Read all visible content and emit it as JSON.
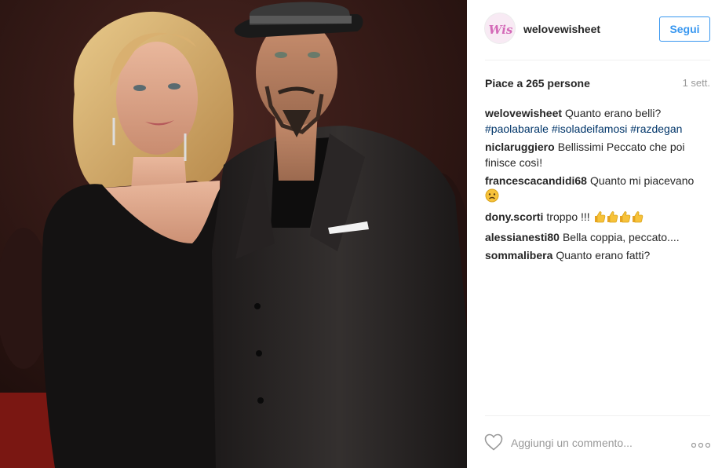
{
  "post": {
    "username": "welovewisheet",
    "avatar_text": "Wis",
    "follow_label": "Segui",
    "likes_text": "Piace a 265 persone",
    "time_text": "1 sett.",
    "comment_placeholder": "Aggiungi un commento...",
    "caption": {
      "user": "welovewisheet",
      "text": "Quanto erano belli?",
      "hashtags": [
        "#paolabarale",
        "#isoladeifamosi",
        "#razdegan"
      ]
    },
    "comments": [
      {
        "user": "niclaruggiero",
        "text": "Bellissimi Peccato che poi finisce così!"
      },
      {
        "user": "francescacandidi68",
        "text": "Quanto mi piacevano",
        "emoji": "sad-face-icon"
      },
      {
        "user": "dony.scorti",
        "text": "troppo !!!",
        "emoji": "thumbs-up-icon"
      },
      {
        "user": "alessianesti80",
        "text": "Bella coppia, peccato...."
      },
      {
        "user": "sommalibera",
        "text": "Quanto erano fatti?"
      }
    ]
  },
  "colors": {
    "accent": "#3897f0",
    "hashtag": "#003569",
    "muted": "#999999",
    "text": "#262626"
  },
  "icons": [
    "heart-icon",
    "more-options-icon",
    "thumbs-up-icon",
    "sad-face-icon"
  ]
}
